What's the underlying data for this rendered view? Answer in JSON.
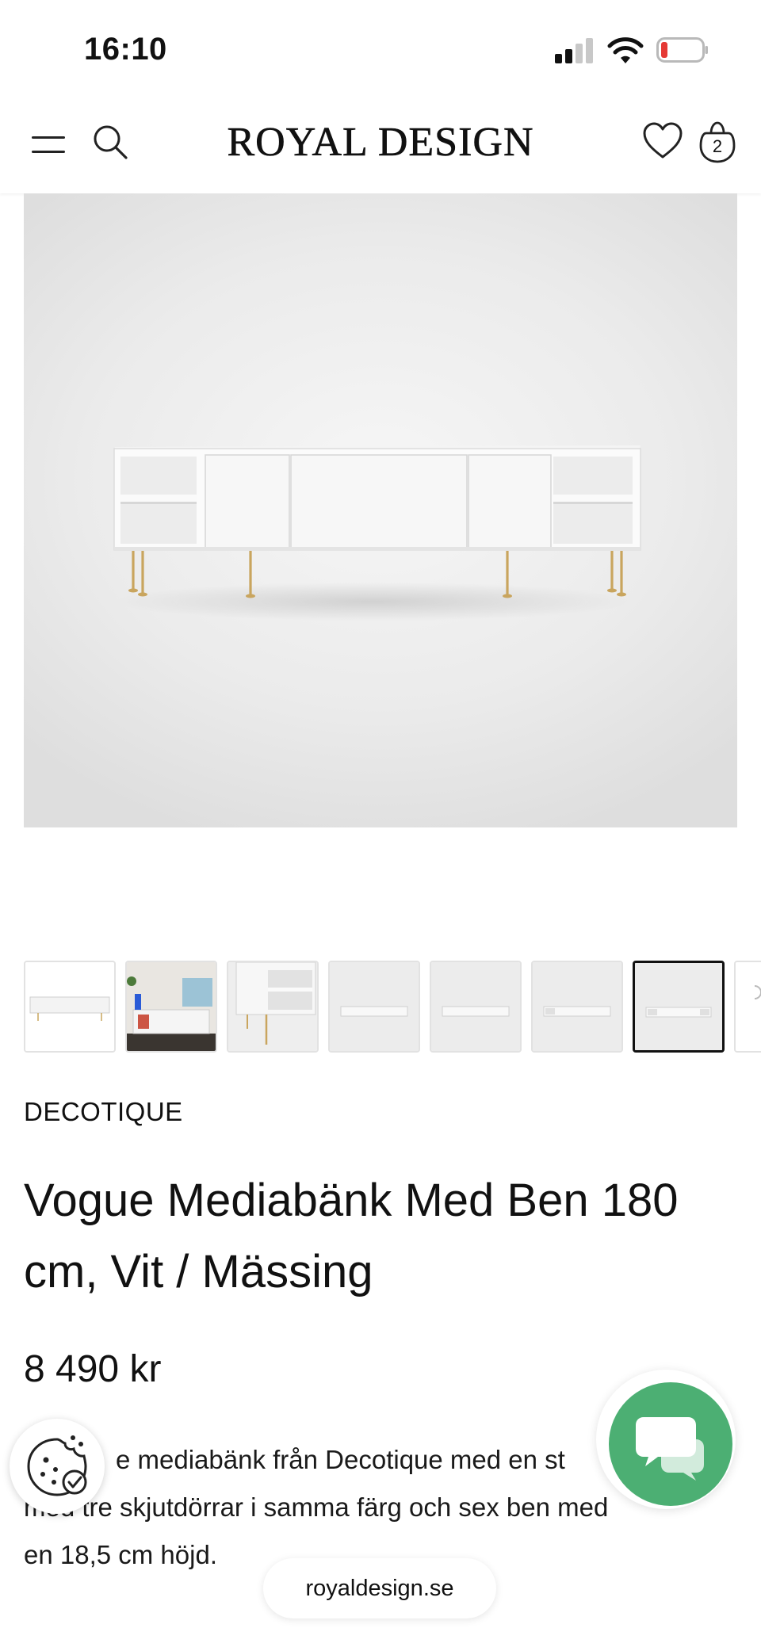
{
  "status_bar": {
    "time": "16:10"
  },
  "header": {
    "brand": "ROYAL DESIGN",
    "cart_count": "2",
    "icons": [
      "menu-icon",
      "search-icon",
      "heart-icon",
      "bag-icon"
    ]
  },
  "gallery": {
    "thumbnail_count": 8,
    "active_index": 6
  },
  "product": {
    "brand": "DECOTIQUE",
    "title": "Vogue Mediabänk Med Ben 180 cm, Vit / Mässing",
    "price": "8 490 kr",
    "description_visible": "e mediabänk från Decotique med en st",
    "description_line2": "med tre skjutdörrar i samma färg och sex ben med",
    "description_line3": "en 18,5 cm höjd."
  },
  "browser": {
    "url": "royaldesign.se"
  },
  "colors": {
    "chat_green": "#4caf73",
    "battery_red": "#e53935"
  }
}
